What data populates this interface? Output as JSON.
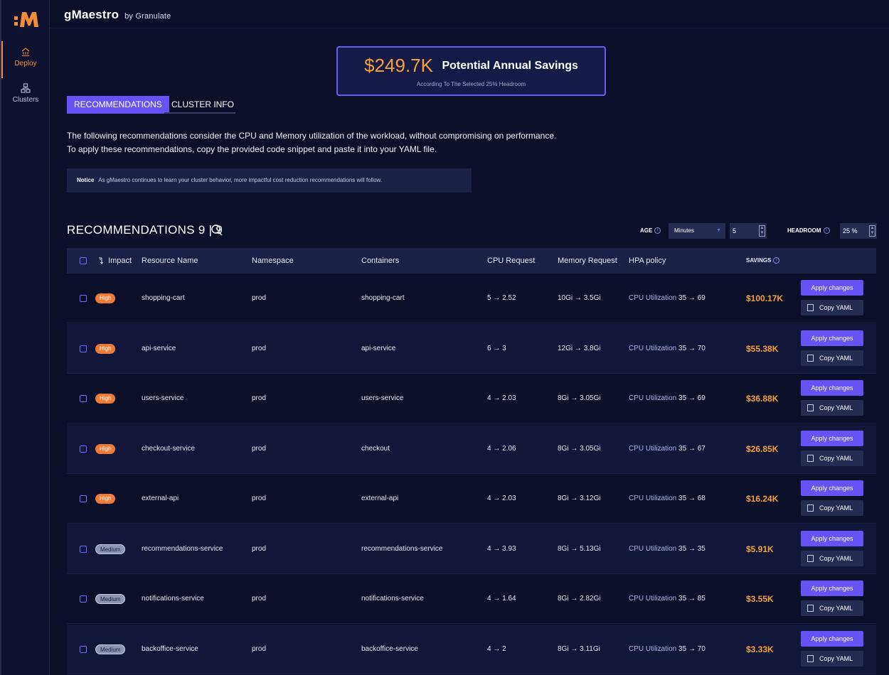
{
  "app": {
    "brand": "gMaestro",
    "brand_sub": "by Granulate"
  },
  "sidebar": {
    "items": [
      {
        "label": "Deploy",
        "icon": "home-icon"
      },
      {
        "label": "Clusters",
        "icon": "clusters-icon"
      }
    ]
  },
  "savings": {
    "amount": "$249.7K",
    "title": "Potential Annual Savings",
    "subtitle": "According To The Selected 25% Headroom"
  },
  "tabs": [
    {
      "label": "RECOMMENDATIONS"
    },
    {
      "label": "CLUSTER INFO"
    }
  ],
  "description": {
    "line1": "The following recommendations consider the CPU and Memory utilization of the workload, without compromising on performance.",
    "line2": "To apply these recommendations, copy the provided code snippet and paste it into your YAML file."
  },
  "notice": {
    "label": "Notice",
    "text": "As gMaestro continues to learn your cluster behavior, more impactful cost reduction recommendations will follow."
  },
  "recommendations": {
    "title": "RECOMMENDATIONS 9 | 9",
    "age_label": "AGE",
    "age_unit": "Minutes",
    "age_value": "5",
    "headroom_label": "HEADROOM",
    "headroom_value": "25 %"
  },
  "table": {
    "headers": {
      "impact": "Impact",
      "resource": "Resource Name",
      "namespace": "Namespace",
      "containers": "Containers",
      "cpu": "CPU Request",
      "memory": "Memory Request",
      "hpa": "HPA policy",
      "savings": "SAVINGS"
    },
    "apply_label": "Apply changes",
    "copy_label": "Copy YAML",
    "hpa_prefix": "CPU Utilization",
    "rows": [
      {
        "impact": "High",
        "resource": "shopping-cart",
        "namespace": "prod",
        "containers": "shopping-cart",
        "cpu_from": "5",
        "cpu_to": "2.52",
        "mem_from": "10Gi",
        "mem_to": "3.5Gi",
        "hpa_from": "35",
        "hpa_to": "69",
        "savings": "$100.17K"
      },
      {
        "impact": "High",
        "resource": "api-service",
        "namespace": "prod",
        "containers": "api-service",
        "cpu_from": "6",
        "cpu_to": "3",
        "mem_from": "12Gi",
        "mem_to": "3.8Gi",
        "hpa_from": "35",
        "hpa_to": "70",
        "savings": "$55.38K"
      },
      {
        "impact": "High",
        "resource": "users-service",
        "namespace": "prod",
        "containers": "users-service",
        "cpu_from": "4",
        "cpu_to": "2.03",
        "mem_from": "8Gi",
        "mem_to": "3.05Gi",
        "hpa_from": "35",
        "hpa_to": "69",
        "savings": "$36.88K"
      },
      {
        "impact": "High",
        "resource": "checkout-service",
        "namespace": "prod",
        "containers": "checkout",
        "cpu_from": "4",
        "cpu_to": "2.06",
        "mem_from": "8Gi",
        "mem_to": "3.05Gi",
        "hpa_from": "35",
        "hpa_to": "67",
        "savings": "$26.85K"
      },
      {
        "impact": "High",
        "resource": "external-api",
        "namespace": "prod",
        "containers": "external-api",
        "cpu_from": "4",
        "cpu_to": "2.03",
        "mem_from": "8Gi",
        "mem_to": "3.12Gi",
        "hpa_from": "35",
        "hpa_to": "68",
        "savings": "$16.24K"
      },
      {
        "impact": "Medium",
        "resource": "recommendations-service",
        "namespace": "prod",
        "containers": "recommendations-service",
        "cpu_from": "4",
        "cpu_to": "3.93",
        "mem_from": "8Gi",
        "mem_to": "5.13Gi",
        "hpa_from": "35",
        "hpa_to": "35",
        "savings": "$5.91K"
      },
      {
        "impact": "Medium",
        "resource": "notifications-service",
        "namespace": "prod",
        "containers": "notifications-service",
        "cpu_from": "4",
        "cpu_to": "1.64",
        "mem_from": "8Gi",
        "mem_to": "2.82Gi",
        "hpa_from": "35",
        "hpa_to": "85",
        "savings": "$3.55K"
      },
      {
        "impact": "Medium",
        "resource": "backoffice-service",
        "namespace": "prod",
        "containers": "backoffice-service",
        "cpu_from": "4",
        "cpu_to": "2",
        "mem_from": "8Gi",
        "mem_to": "3.11Gi",
        "hpa_from": "35",
        "hpa_to": "70",
        "savings": "$3.33K"
      }
    ]
  },
  "colors": {
    "accent": "#6652f5",
    "savings": "#f4a03c",
    "high": "#ee7a36",
    "medium": "#8d95b3",
    "background": "#0b0f2a"
  }
}
